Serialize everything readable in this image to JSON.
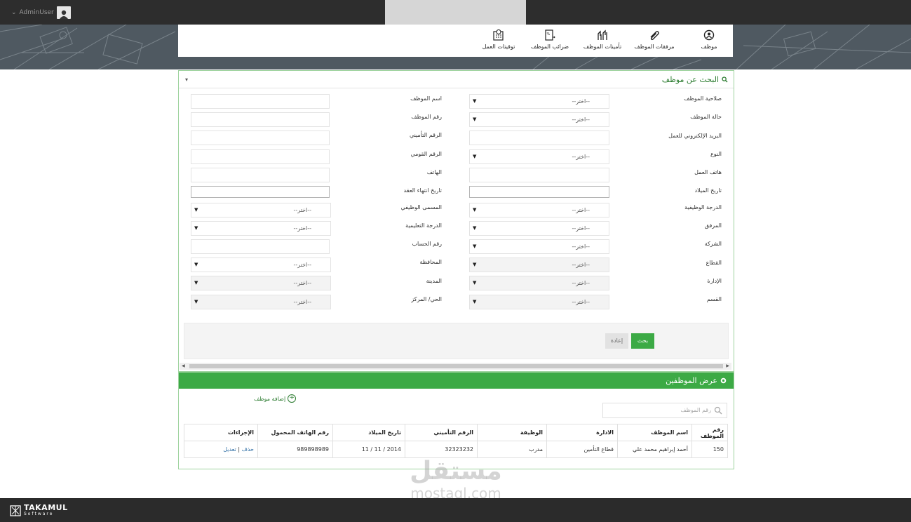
{
  "topbar": {
    "username": "AdminUser"
  },
  "nav": [
    {
      "label": "موظف",
      "icon": "person-pin-icon"
    },
    {
      "label": "مرفقات الموظف",
      "icon": "paperclip-icon"
    },
    {
      "label": "تأمينات الموظف",
      "icon": "hands-icon"
    },
    {
      "label": "ضرائب الموظف",
      "icon": "tax-doc-icon"
    },
    {
      "label": "توقيتات العمل",
      "icon": "clock-calculator-icon"
    }
  ],
  "search": {
    "title": "البحث عن موظف",
    "select_placeholder": "--اختر--",
    "right_labels": [
      "صلاحية الموظف",
      "حالة الموظف",
      "البريد الإلكتروني للعمل",
      "النوع",
      "هاتف العمل",
      "تاريخ الميلاد",
      "الدرجة الوظيفية",
      "المرفق",
      "الشركة",
      "القطاع",
      "الإدارة",
      "القسم"
    ],
    "left_labels": [
      "اسم الموظف",
      "رقم الموظف",
      "الرقم التأميني",
      "الرقم القومي",
      "الهاتف",
      "تاريخ انتهاء العقد",
      "المسمى الوظيفي",
      "الدرجة التعليمية",
      "رقم الحساب",
      "المحافظة",
      "المدينة",
      "الحي/ المركز"
    ],
    "search_button": "بحث",
    "reset_button": "إعادة"
  },
  "list": {
    "title": "عرض الموظفين",
    "add_label": "إضافة موظف",
    "search_placeholder": "رقم الموظف",
    "columns": [
      "رقم الموظف",
      "اسم الموظف",
      "الادارة",
      "الوظيفة",
      "الرقم التأميني",
      "تاريخ الميلاد",
      "رقم الهاتف المحمول",
      "الإجراءات"
    ],
    "rows": [
      {
        "id": "150",
        "name": "أحمد إبراهيم محمد علي",
        "dept": "قطاع التأمين",
        "job": "مدرب",
        "insurance": "32323232",
        "birth": "2014 / 11 / 11",
        "mobile": "989898989",
        "delete": "حذف",
        "sep": "|",
        "edit": "تعديل"
      }
    ]
  },
  "footer": {
    "brand": "TAKAMUL",
    "sub": "Software"
  },
  "watermark": {
    "arabic": "مستقل",
    "latin": "mostaql.com"
  }
}
